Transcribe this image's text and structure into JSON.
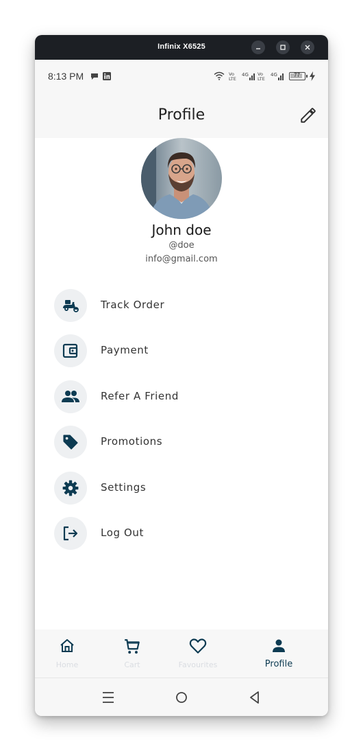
{
  "window": {
    "title": "Infinix X6525",
    "controls": [
      "minimize-icon",
      "maximize-icon",
      "close-icon"
    ]
  },
  "status_bar": {
    "time": "8:13 PM",
    "battery": "77",
    "icons": [
      "chat-bubble-icon",
      "linkedin-icon",
      "wifi-icon",
      "signal-icon",
      "battery-icon",
      "charging-icon"
    ]
  },
  "app_bar": {
    "title": "Profile",
    "edit_icon": "pencil-icon"
  },
  "profile": {
    "name": "John doe",
    "handle": "@doe",
    "email": "info@gmail.com"
  },
  "menu": [
    {
      "label": "Track Order",
      "icon": "scooter-icon"
    },
    {
      "label": "Payment",
      "icon": "wallet-icon"
    },
    {
      "label": "Refer A Friend",
      "icon": "people-icon"
    },
    {
      "label": "Promotions",
      "icon": "tag-icon"
    },
    {
      "label": "Settings",
      "icon": "gear-icon"
    },
    {
      "label": "Log Out",
      "icon": "logout-icon"
    }
  ],
  "bottom_nav": [
    {
      "label": "Home",
      "icon": "home-icon",
      "active": false
    },
    {
      "label": "Cart",
      "icon": "cart-icon",
      "active": false
    },
    {
      "label": "Favourites",
      "icon": "heart-icon",
      "active": false
    },
    {
      "label": "Profile",
      "icon": "person-icon",
      "active": true
    }
  ],
  "system_nav": [
    "menu-icon",
    "home-circle-icon",
    "back-icon"
  ],
  "colors": {
    "accent": "#0d3b52",
    "icon_bg": "#eef0f2",
    "titlebar": "#1c1f24",
    "surface": "#f7f7f7"
  }
}
